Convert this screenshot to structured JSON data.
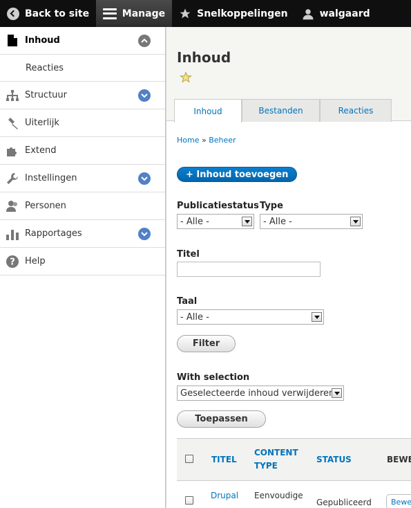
{
  "toolbar": {
    "back_label": "Back to site",
    "manage_label": "Manage",
    "shortcuts_label": "Snelkoppelingen",
    "user_label": "walgaard"
  },
  "sidebar": {
    "items": [
      {
        "label": "Inhoud",
        "icon": "file-icon",
        "toggle": "up"
      },
      {
        "label": "Reacties",
        "icon": "",
        "toggle": ""
      },
      {
        "label": "Structuur",
        "icon": "structure-icon",
        "toggle": "down"
      },
      {
        "label": "Uiterlijk",
        "icon": "brush-icon",
        "toggle": ""
      },
      {
        "label": "Extend",
        "icon": "puzzle-icon",
        "toggle": ""
      },
      {
        "label": "Instellingen",
        "icon": "wrench-icon",
        "toggle": "down"
      },
      {
        "label": "Personen",
        "icon": "people-icon",
        "toggle": ""
      },
      {
        "label": "Rapportages",
        "icon": "bar-chart-icon",
        "toggle": "down"
      },
      {
        "label": "Help",
        "icon": "help-icon",
        "toggle": ""
      }
    ],
    "accent_color": "#5181c6"
  },
  "page": {
    "title": "Inhoud",
    "tabs": [
      "Inhoud",
      "Bestanden",
      "Reacties"
    ],
    "breadcrumb": {
      "home": "Home",
      "separator": "»",
      "current": "Beheer"
    },
    "add_button": "+ Inhoud toevoegen"
  },
  "filters": {
    "status_label": "Publicatiestatus",
    "status_value": "- Alle -",
    "type_label": "Type",
    "type_value": "- Alle -",
    "title_label": "Titel",
    "title_value": "",
    "language_label": "Taal",
    "language_value": "- Alle -",
    "filter_button": "Filter"
  },
  "bulk": {
    "label": "With selection",
    "action_value": "Geselecteerde inhoud verwijderen",
    "apply_button": "Toepassen"
  },
  "table": {
    "headers": {
      "title": "TITEL",
      "content_type_1": "CONTENT",
      "content_type_2": "TYPE",
      "status": "STATUS",
      "operations": "BEWE"
    },
    "rows": [
      {
        "title": "Drupal",
        "content_type": "Eenvoudige",
        "status": "Gepubliceerd",
        "operation": "Bewe"
      }
    ]
  }
}
